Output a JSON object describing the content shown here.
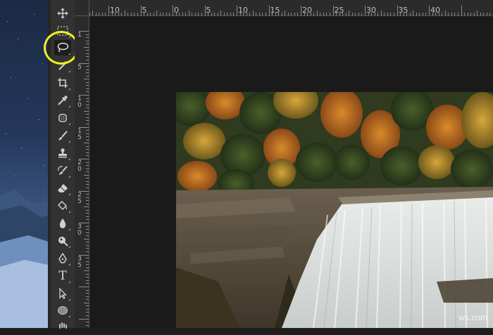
{
  "toolbar": {
    "tools": [
      {
        "name": "move-tool",
        "icon": "move-icon"
      },
      {
        "name": "marquee-tool",
        "icon": "marquee-icon"
      },
      {
        "name": "lasso-tool",
        "icon": "lasso-icon",
        "selected": true
      },
      {
        "name": "quick-selection-tool",
        "icon": "magic-wand-icon"
      },
      {
        "name": "crop-tool",
        "icon": "crop-icon"
      },
      {
        "name": "eyedropper-tool",
        "icon": "eyedropper-icon"
      },
      {
        "name": "spot-healing-tool",
        "icon": "bandage-icon"
      },
      {
        "name": "brush-tool",
        "icon": "brush-icon"
      },
      {
        "name": "clone-stamp-tool",
        "icon": "stamp-icon"
      },
      {
        "name": "history-brush-tool",
        "icon": "history-brush-icon"
      },
      {
        "name": "eraser-tool",
        "icon": "eraser-icon"
      },
      {
        "name": "paint-bucket-tool",
        "icon": "paint-bucket-icon"
      },
      {
        "name": "blur-tool",
        "icon": "drop-icon"
      },
      {
        "name": "dodge-tool",
        "icon": "dodge-icon"
      },
      {
        "name": "pen-tool",
        "icon": "pen-icon"
      },
      {
        "name": "type-tool",
        "icon": "type-icon",
        "label": "T"
      },
      {
        "name": "path-selection-tool",
        "icon": "arrow-icon"
      },
      {
        "name": "ellipse-tool",
        "icon": "ellipse-icon"
      },
      {
        "name": "hand-tool",
        "icon": "hand-icon"
      }
    ]
  },
  "ruler_top": {
    "labels": [
      "10",
      "5",
      "0",
      "5",
      "10",
      "15",
      "20",
      "25",
      "30",
      "35",
      "40"
    ]
  },
  "ruler_left": {
    "labels": [
      "1",
      "5",
      "1\n0",
      "1\n5",
      "2\n0",
      "2\n5",
      "3\n0",
      "3\n5"
    ]
  },
  "canvas": {
    "watermark": "ws.com"
  },
  "colors": {
    "highlight": "#f2ef24",
    "toolbar_bg": "#323232",
    "canvas_bg": "#1a1a1a"
  }
}
